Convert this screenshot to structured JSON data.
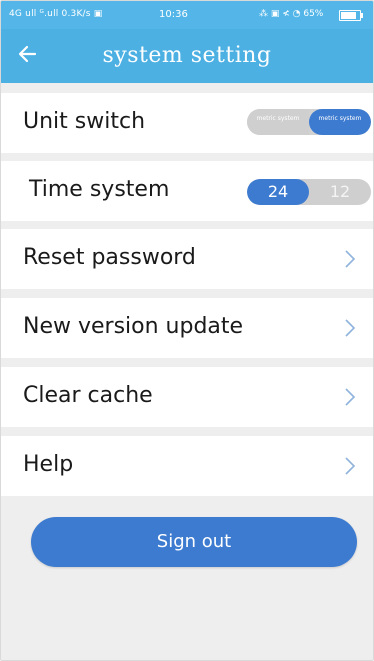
{
  "status_bar": {
    "left_text": "4G ull  ᴳ.ull 0.3K/s ▣",
    "time": "10:36",
    "right_text": "⁂ ▣ ≮ ◔ 65%"
  },
  "header": {
    "title": "system setting",
    "back_icon": "back-arrow-icon"
  },
  "settings": {
    "unit_switch": {
      "label": "Unit switch",
      "option_off": "metric system",
      "option_on": "metric system"
    },
    "time_system": {
      "label": "Time system",
      "option_24": "24",
      "option_12": "12"
    },
    "reset_password": {
      "label": "Reset password"
    },
    "new_version_update": {
      "label": "New version update"
    },
    "clear_cache": {
      "label": "Clear cache"
    },
    "help": {
      "label": "Help"
    }
  },
  "sign_out": {
    "label": "Sign out"
  },
  "colors": {
    "header": "#4cb0e3",
    "accent": "#3d7bd0",
    "background": "#eeeeee",
    "toggle_off": "#cfcfcf"
  }
}
